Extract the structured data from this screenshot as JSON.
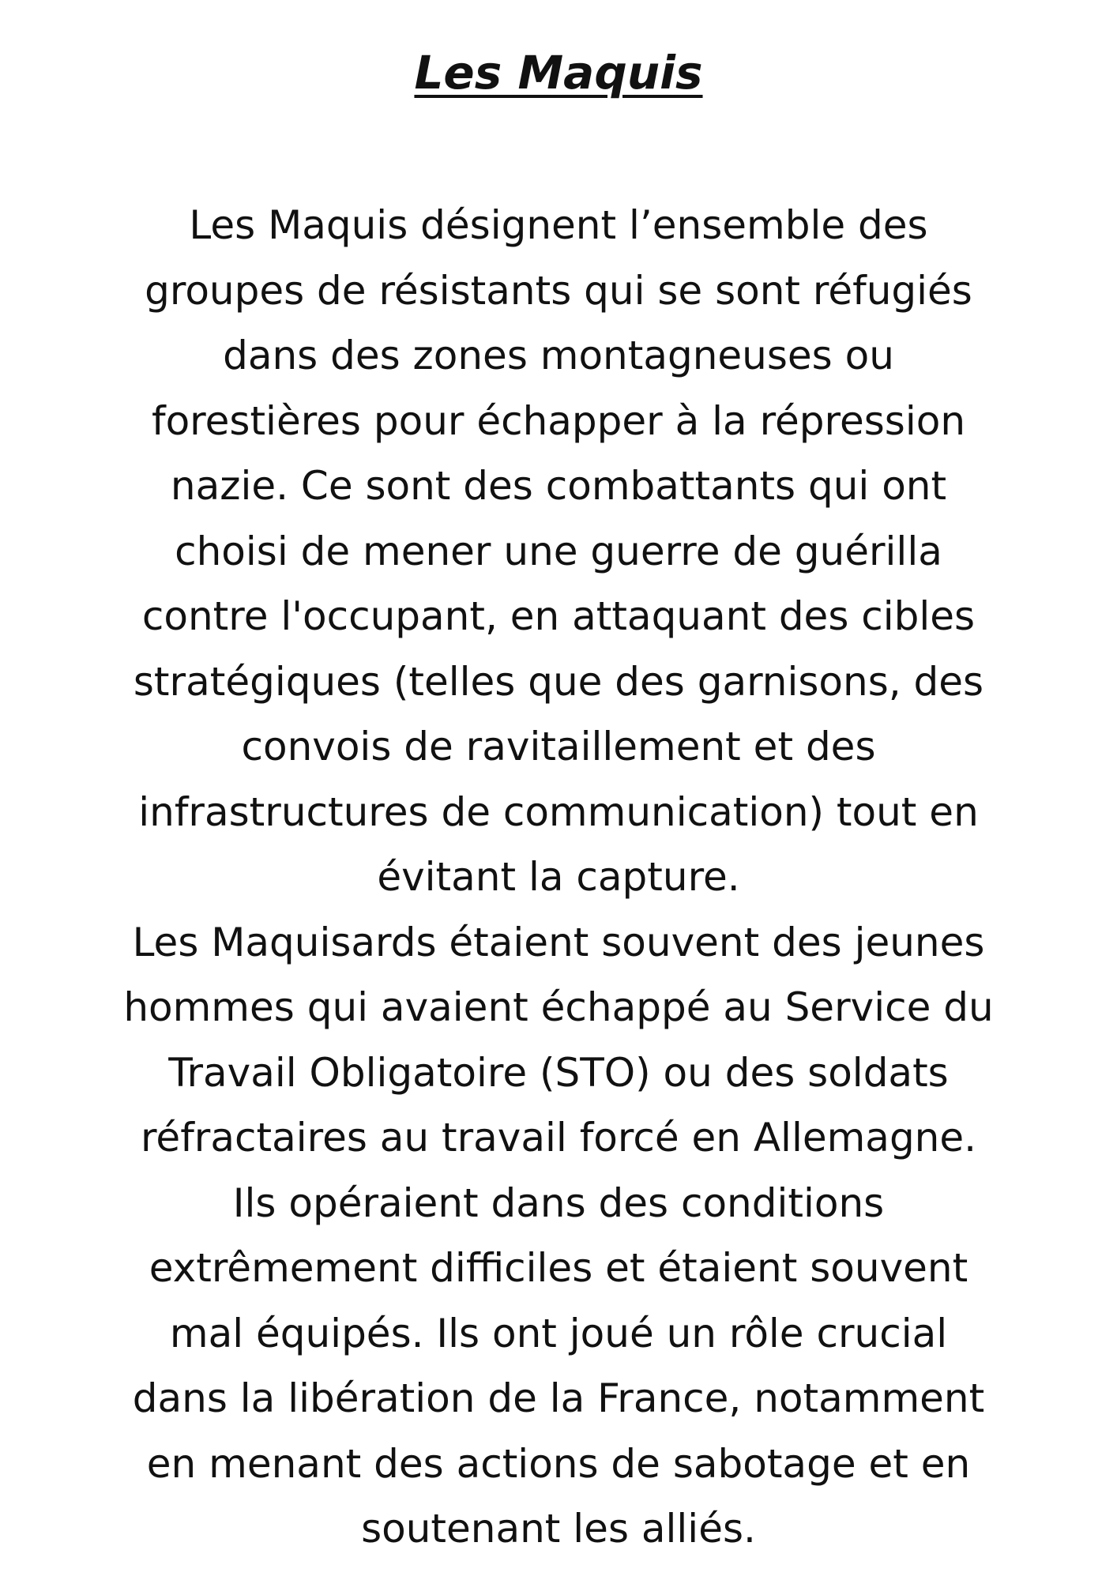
{
  "document": {
    "title": "Les Maquis",
    "lines": [
      "Les Maquis désignent l’ensemble des",
      "groupes de résistants qui se sont réfugiés",
      "dans des zones montagneuses ou",
      "forestières pour échapper à la répression",
      "nazie. Ce sont des combattants qui ont",
      "choisi de mener une guerre de guérilla",
      "contre l'occupant, en attaquant des cibles",
      "stratégiques (telles que des garnisons, des",
      "convois de ravitaillement et des",
      "infrastructures de communication) tout en",
      "évitant la capture.",
      "Les Maquisards étaient souvent des jeunes",
      "hommes qui avaient échappé au Service du",
      "Travail Obligatoire (STO) ou des soldats",
      "réfractaires au travail forcé en Allemagne.",
      "Ils opéraient dans des conditions",
      "extrêmement difficiles et étaient souvent",
      "mal équipés. Ils ont joué un rôle crucial",
      "dans la libération de la France, notamment",
      "en menant des actions de sabotage et en",
      "soutenant les alliés."
    ]
  }
}
